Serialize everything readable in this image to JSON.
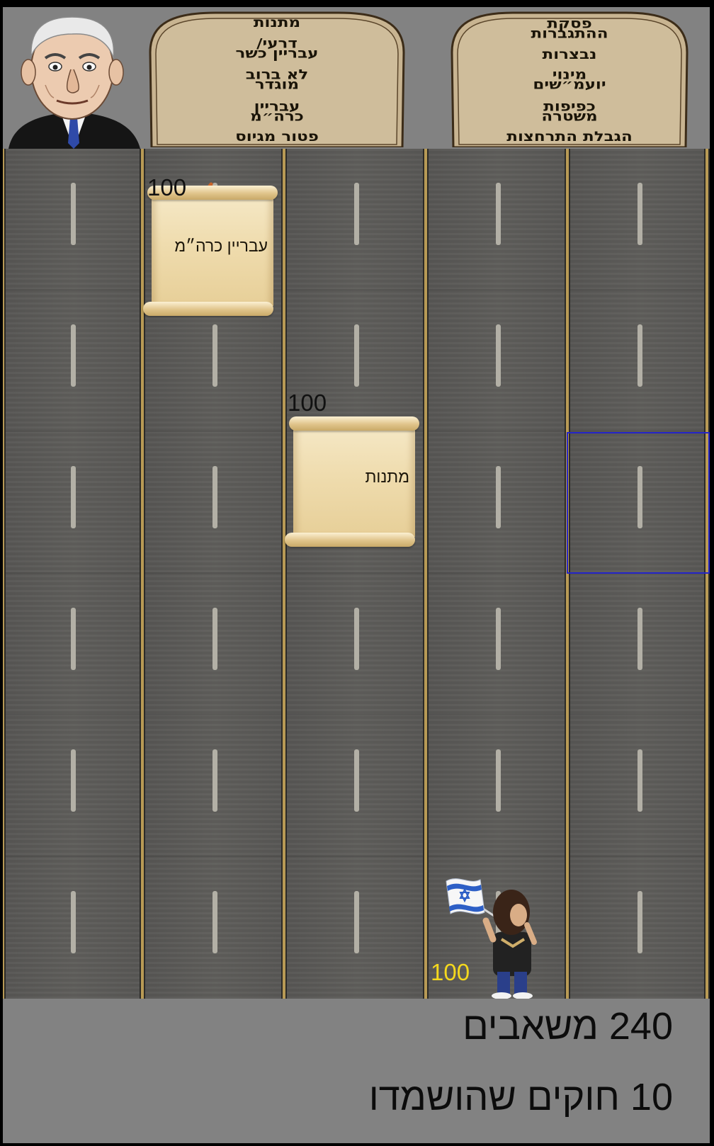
{
  "header": {
    "portrait_name": "prime-minister-caricature",
    "tablets": [
      {
        "name": "rights-tablet",
        "lines": [
          "פסקת\nההתגברות",
          "נבצרות",
          "מינוי\nיועמ״שים",
          "כפיפות\nמשטרה",
          "הגבלת התרחצות"
        ]
      },
      {
        "name": "laws-tablet",
        "lines": [
          "מתנות",
          "דרעי/\nעבריין כשר",
          "לא ברוב\nמוגדר",
          "עבריין\nכרה״מ",
          "פטור מגיוס"
        ]
      }
    ]
  },
  "board": {
    "lanes": 5,
    "enemies": [
      {
        "label": "עבריין כרה״מ",
        "hp": "100",
        "lane": 1,
        "row": 0
      },
      {
        "label": "מתנות",
        "hp": "100",
        "lane": 2,
        "row": 2
      }
    ],
    "player": {
      "hp": "100",
      "lane": 3,
      "row": 6,
      "sprite": "protester-with-israeli-flag"
    },
    "selected_tile": {
      "lane": 4,
      "row": 2
    }
  },
  "footer": {
    "resources": "240 משאבים",
    "laws_destroyed": "10 חוקים שהושמדו"
  },
  "colors": {
    "panel": "#828282",
    "road": "#5b5a58",
    "lane_line": "#b89a55",
    "player_hp": "#f4d81e",
    "selection": "#2424c8"
  }
}
